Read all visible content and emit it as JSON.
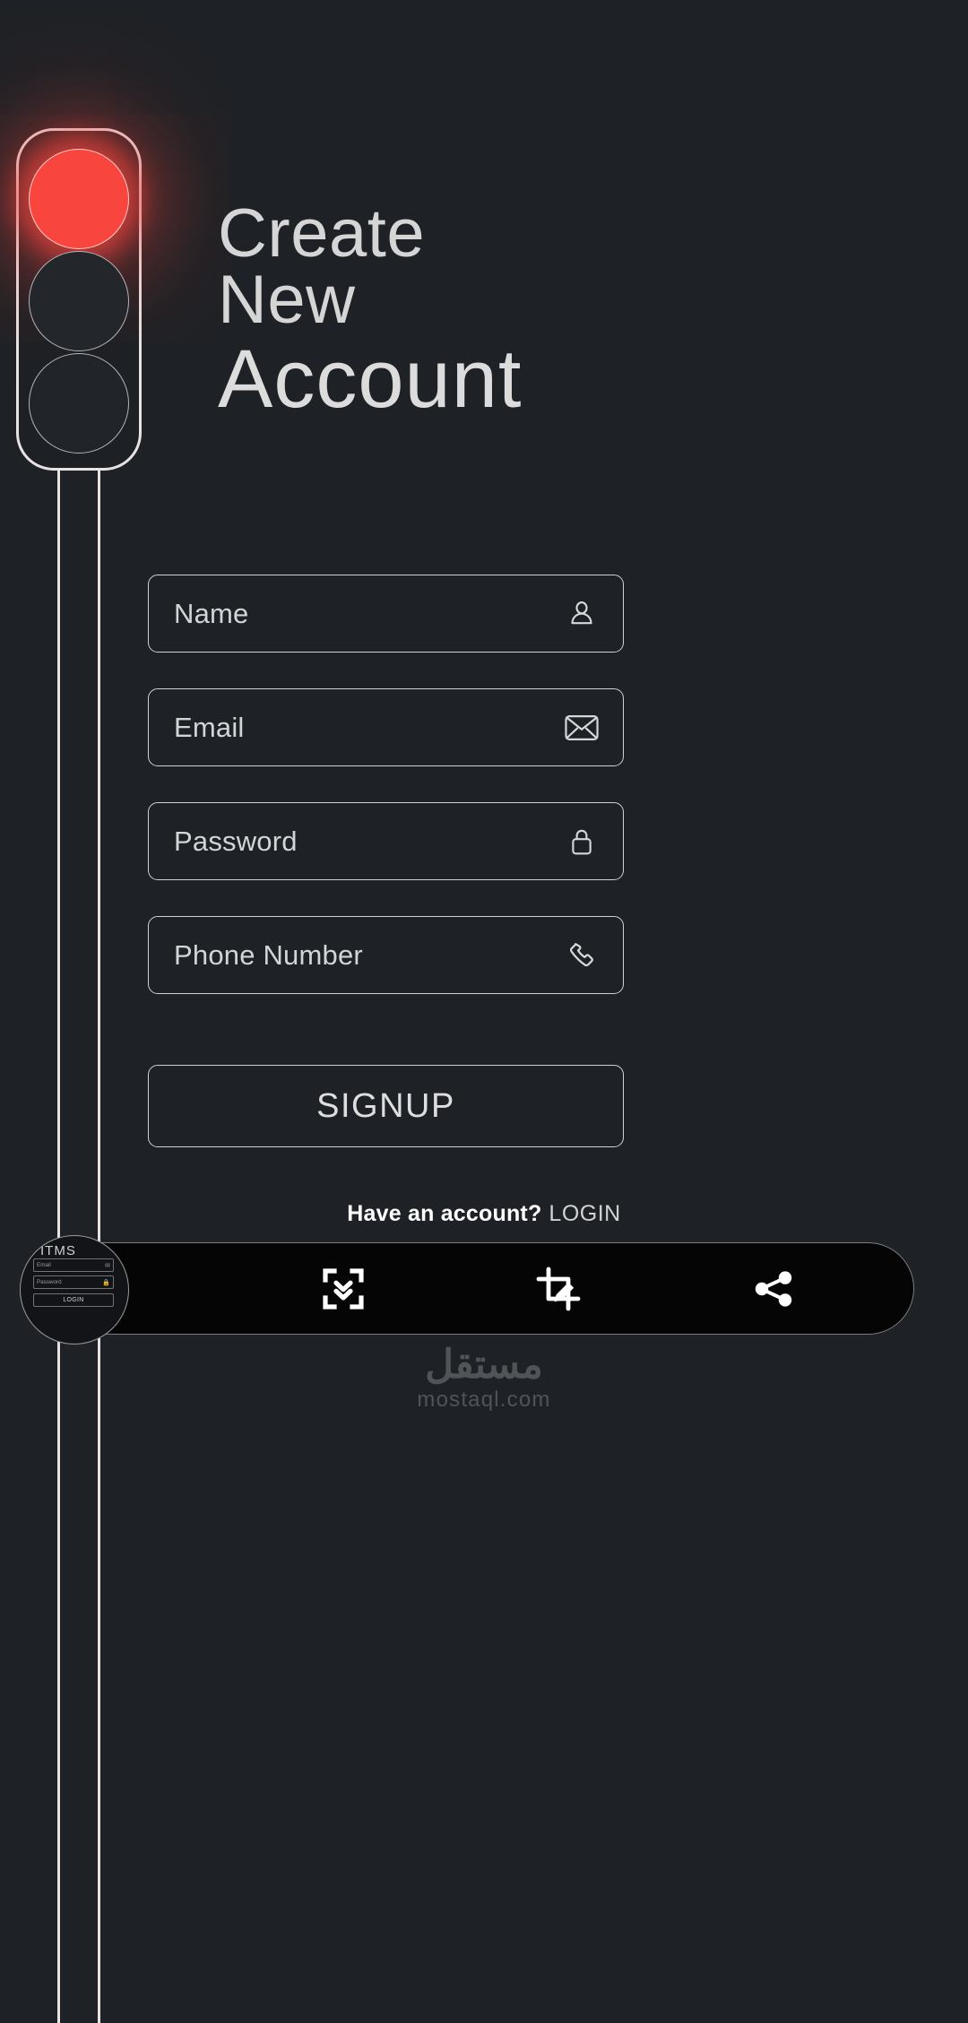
{
  "app": {
    "background_color": "#1e2226",
    "accent_color": "#f8463f"
  },
  "traffic_light": {
    "lamps": [
      {
        "name": "red",
        "state": "on",
        "color": "#f8463f"
      },
      {
        "name": "amber",
        "state": "off",
        "color": "#23262a"
      },
      {
        "name": "green",
        "state": "off",
        "color": "#212529"
      }
    ]
  },
  "heading": {
    "line1": "Create",
    "line2": "New",
    "line3": "Account"
  },
  "form": {
    "fields": [
      {
        "label": "Name",
        "icon": "person-icon",
        "value": ""
      },
      {
        "label": "Email",
        "icon": "envelope-icon",
        "value": ""
      },
      {
        "label": "Password",
        "icon": "lock-icon",
        "value": ""
      },
      {
        "label": "Phone Number",
        "icon": "phone-icon",
        "value": ""
      }
    ],
    "signup_label": "SIGNUP"
  },
  "login_prompt": {
    "question": "Have an account?",
    "link": "LOGIN"
  },
  "bottom_bar": {
    "icons": [
      {
        "name": "fit-to-screen-icon",
        "label": "Fit"
      },
      {
        "name": "crop-edit-icon",
        "label": "Crop"
      },
      {
        "name": "share-icon",
        "label": "Share"
      }
    ]
  },
  "thumbnail": {
    "title": "ITMS",
    "fields": [
      {
        "label": "Email",
        "icon": "envelope-icon"
      },
      {
        "label": "Password",
        "icon": "lock-icon"
      }
    ],
    "button_label": "LOGIN"
  },
  "watermark": {
    "arabic": "مستقل",
    "latin": "mostaql.com"
  }
}
